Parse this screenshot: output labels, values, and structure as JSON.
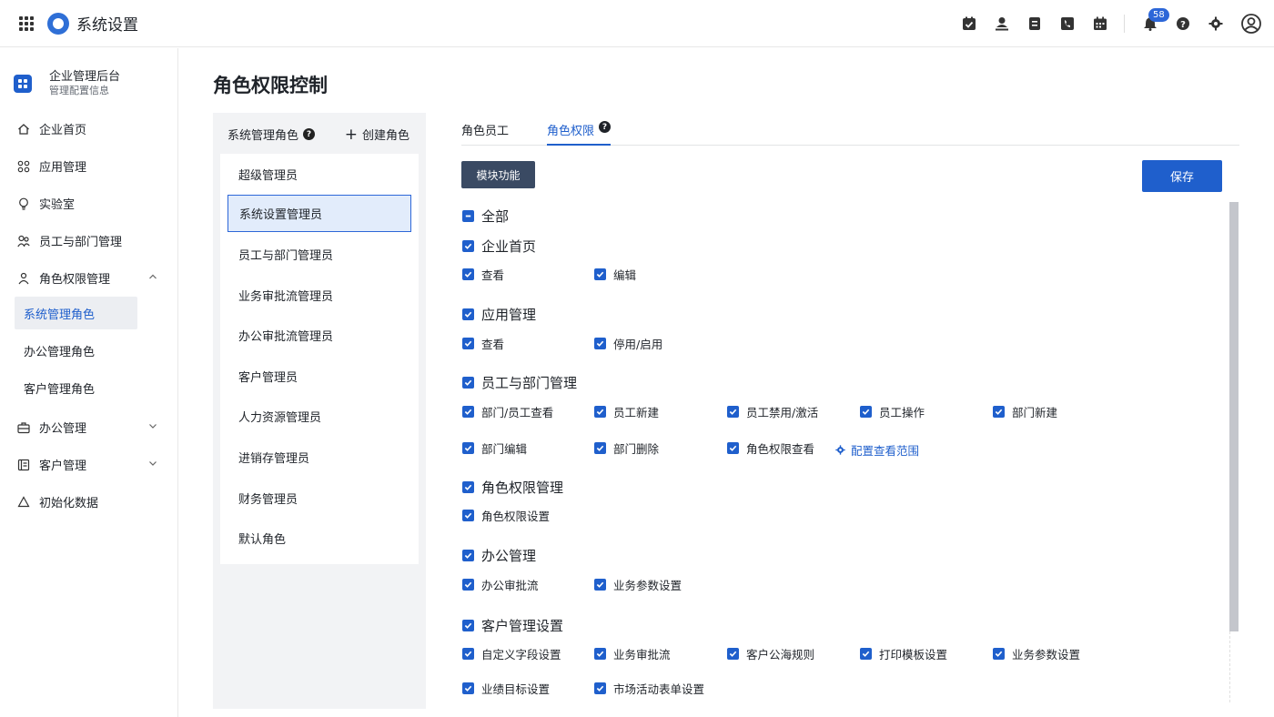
{
  "app": {
    "title": "系统设置"
  },
  "header": {
    "notification_count": "58"
  },
  "sidebar": {
    "org_name": "企业管理后台",
    "org_sub": "管理配置信息",
    "items": [
      {
        "label": "企业首页",
        "icon": "home-icon"
      },
      {
        "label": "应用管理",
        "icon": "apps-icon"
      },
      {
        "label": "实验室",
        "icon": "lightbulb-icon"
      },
      {
        "label": "员工与部门管理",
        "icon": "users-icon"
      },
      {
        "label": "角色权限管理",
        "icon": "user-role-icon"
      }
    ],
    "sub_items": [
      "系统管理角色",
      "办公管理角色",
      "客户管理角色"
    ],
    "bottom_items": [
      {
        "label": "办公管理",
        "icon": "briefcase-icon"
      },
      {
        "label": "客户管理",
        "icon": "contacts-icon"
      },
      {
        "label": "初始化数据",
        "icon": "recycle-icon"
      }
    ]
  },
  "main": {
    "title": "角色权限控制",
    "role_panel": {
      "heading": "系统管理角色",
      "create_label": "创建角色",
      "roles": [
        "超级管理员",
        "系统设置管理员",
        "员工与部门管理员",
        "业务审批流管理员",
        "办公审批流管理员",
        "客户管理员",
        "人力资源管理员",
        "进销存管理员",
        "财务管理员",
        "默认角色"
      ]
    },
    "tabs": [
      "角色员工",
      "角色权限"
    ],
    "module_button": "模块功能",
    "save_button": "保存",
    "all_label": "全部",
    "groups": [
      {
        "label": "企业首页",
        "items": [
          "查看",
          "编辑"
        ]
      },
      {
        "label": "应用管理",
        "items": [
          "查看",
          "停用/启用"
        ]
      },
      {
        "label": "员工与部门管理",
        "items": [
          "部门/员工查看",
          "员工新建",
          "员工禁用/激活",
          "员工操作",
          "部门新建",
          "部门编辑",
          "部门删除",
          "角色权限查看"
        ]
      },
      {
        "label": "角色权限管理",
        "items": [
          "角色权限设置"
        ]
      },
      {
        "label": "办公管理",
        "items": [
          "办公审批流",
          "业务参数设置"
        ]
      },
      {
        "label": "客户管理设置",
        "items": [
          "自定义字段设置",
          "业务审批流",
          "客户公海规则",
          "打印模板设置",
          "业务参数设置",
          "业绩目标设置",
          "市场活动表单设置"
        ]
      }
    ],
    "config_link": "配置查看范围"
  }
}
